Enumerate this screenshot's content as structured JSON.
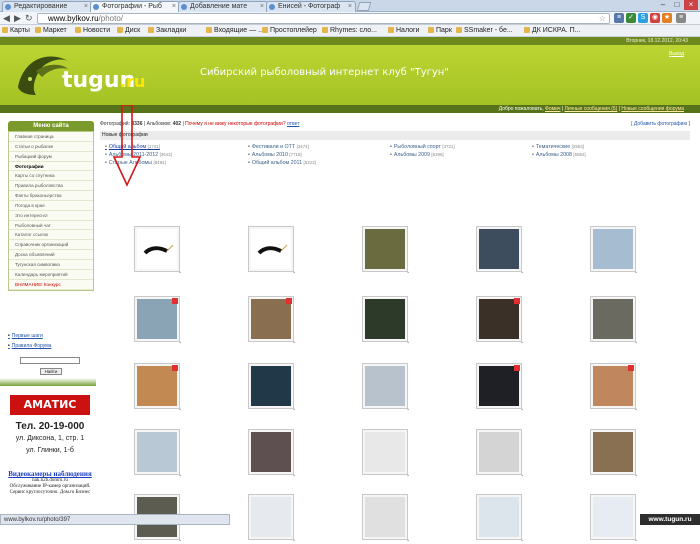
{
  "browser": {
    "tabs": [
      {
        "title": "Редактирование",
        "active": false
      },
      {
        "title": "Фотографии - Рыб",
        "active": true
      },
      {
        "title": "Добавление мате",
        "active": false
      },
      {
        "title": "Енисей - Фотограф",
        "active": false
      }
    ],
    "url_scheme": "www.bylkov.ru",
    "url_path": "/photo/",
    "bookmarks": [
      "Карты",
      "Маркет",
      "Новости",
      "Диск",
      "Закладки",
      "Входящие — ...",
      "Простоплейер",
      "Rhymes: сло...",
      "Налоги",
      "Парк",
      "SSmaker - бе...",
      "ДК ИСКРА. П..."
    ],
    "status_url": "www.bylkov.ru/photo/397",
    "watermark": "www.tugun.ru"
  },
  "site": {
    "date_line": "Вторник, 18.12.2012, 20:43",
    "logo_text": "tugun",
    "logo_suffix": ".ru",
    "club_title": "Сибирский рыболовный интернет клуб \"Тугун\"",
    "lang_link": "Выход",
    "greet_text": "Добро пожаловать,",
    "greet_user": "Фомич",
    "greet_msgs": "Личные сообщения (5)",
    "greet_new": "Новые сообщения форума"
  },
  "sidebar": {
    "menu_title": "Меню сайта",
    "items": [
      {
        "label": "Главная страница"
      },
      {
        "label": "Статьи о рыбалке"
      },
      {
        "label": "Рыбацкий форум"
      },
      {
        "label": "Фотографии",
        "bold": true
      },
      {
        "label": "Карты со спутника"
      },
      {
        "label": "Правила рыболовства"
      },
      {
        "label": "Факты браконьерства"
      },
      {
        "label": "Погода в крае"
      },
      {
        "label": "Это интересно!"
      },
      {
        "label": "Рыболовный чат"
      },
      {
        "label": "Каталог ссылок"
      },
      {
        "label": "Справочник организаций"
      },
      {
        "label": "Доска объявлений"
      },
      {
        "label": "Тугунская символика"
      },
      {
        "label": "Календарь мероприятий"
      },
      {
        "label": "ВНИМАНИЕ! Конкурс",
        "red": true
      }
    ],
    "first_steps": "Первые шаги",
    "rules": "Правила Форума",
    "search_button": "Найти",
    "ad_brand": "АМАТИС",
    "phone_label": "Тел. 20-19-000",
    "addr1": "ул. Диксона, 1, стр. 1",
    "addr2": "ул. Глинки, 1-б",
    "cams_title": "Видеокамеры наблюдения",
    "cams_site": "nak.h2b.domru.ru",
    "cams_desc": "Обслуживание IP-камер организаций. Сервис круглосуточно. Дом.ru Бизнес"
  },
  "main": {
    "stats_prefix": "Фотографий:",
    "photo_count": "3336",
    "albums_label": "Альбомов:",
    "album_count": "402",
    "warn": "Почему я не вижу некоторые фотографии?",
    "reply": "ответ",
    "add_photo": "[ Добавить фотографию ]",
    "new_photos": "Новые фотографии",
    "albums": [
      {
        "name": "Общий альбом",
        "count": "[1741]",
        "active": true
      },
      {
        "name": "Фестивали и ОТТ",
        "count": "[3474]"
      },
      {
        "name": "Рыболовный спорт",
        "count": "[3721]"
      },
      {
        "name": "Тематические",
        "count": "[2563]"
      },
      {
        "name": "Альбомы 2011-2012",
        "count": "[3643]"
      },
      {
        "name": "Альбомы 2010",
        "count": "[7718]"
      },
      {
        "name": "Альбомы 2009",
        "count": "[6295]"
      },
      {
        "name": "Альбомы 2008",
        "count": "[5552]"
      },
      {
        "name": "Старые Альбомы",
        "count": "[8494]"
      },
      {
        "name": "Общий альбом 2011",
        "count": "[5223]"
      }
    ],
    "thumb_colors": [
      [
        "#ffffff",
        "#ffffff",
        "#6b6b40",
        "#3d4d5e",
        "#a6bcd0"
      ],
      [
        "#8aa3b5",
        "#8a6e50",
        "#2d3a2a",
        "#3a3028",
        "#6a6a60"
      ],
      [
        "#c28a52",
        "#203848",
        "#b8c2cc",
        "#1f2026",
        "#c0865e"
      ],
      [
        "#b8c8d4",
        "#5e5050",
        "#e8e8e8",
        "#d4d4d4",
        "#8a7052"
      ],
      [
        "#5c5c50",
        "#e6eaee",
        "#e0e0e0",
        "#dce4ec",
        "#e6ecf2"
      ]
    ]
  }
}
